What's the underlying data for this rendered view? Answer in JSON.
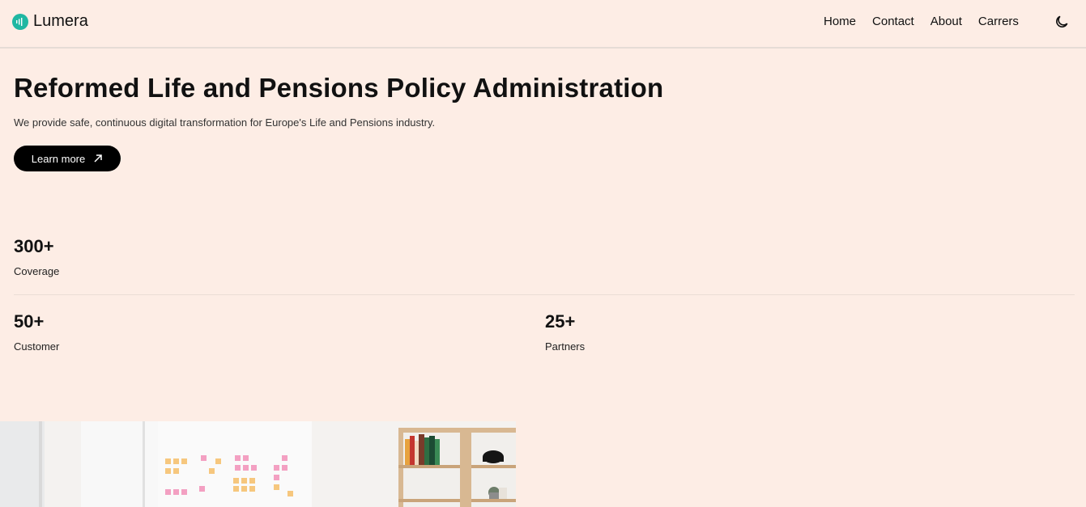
{
  "brand": {
    "name": "Lumera",
    "accent": "#1fb7a2"
  },
  "nav": {
    "items": [
      "Home",
      "Contact",
      "About",
      "Carrers"
    ]
  },
  "hero": {
    "title": "Reformed Life and Pensions Policy Administration",
    "subtitle": "We provide safe, continuous digital transformation for Europe's Life and Pensions industry.",
    "cta_label": "Learn more"
  },
  "stats": [
    {
      "value": "300+",
      "label": "Coverage"
    },
    {
      "value": "50+",
      "label": "Customer"
    },
    {
      "value": "25+",
      "label": "Partners"
    }
  ],
  "icons": {
    "logo": "sound-wave-icon",
    "theme": "moon-icon",
    "cta": "arrow-up-right-icon"
  },
  "colors": {
    "background": "#fdede5",
    "button": "#000000"
  }
}
